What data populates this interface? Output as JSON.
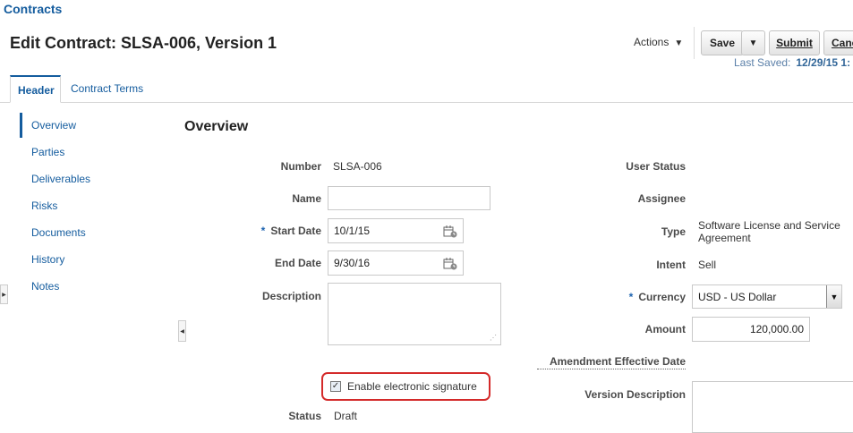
{
  "breadcrumb": "Contracts",
  "page_title": "Edit Contract: SLSA-006, Version 1",
  "toolbar": {
    "actions_label": "Actions",
    "save_label": "Save",
    "submit_label": "Submit",
    "cancel_label": "Canc",
    "last_saved_label": "Last Saved:",
    "last_saved_value": "12/29/15 1:"
  },
  "tabs": [
    {
      "label": "Header",
      "active": true
    },
    {
      "label": "Contract Terms",
      "active": false
    }
  ],
  "sidebar": {
    "items": [
      {
        "label": "Overview",
        "selected": true
      },
      {
        "label": "Parties"
      },
      {
        "label": "Deliverables"
      },
      {
        "label": "Risks"
      },
      {
        "label": "Documents"
      },
      {
        "label": "History"
      },
      {
        "label": "Notes"
      }
    ]
  },
  "overview": {
    "title": "Overview",
    "number_label": "Number",
    "number_value": "SLSA-006",
    "name_label": "Name",
    "name_value": "",
    "start_date_label": "Start Date",
    "start_date_value": "10/1/15",
    "end_date_label": "End Date",
    "end_date_value": "9/30/16",
    "description_label": "Description",
    "description_value": "",
    "esign_label": "Enable electronic signature",
    "esign_checked": true,
    "status_label": "Status",
    "status_value": "Draft",
    "user_status_label": "User Status",
    "assignee_label": "Assignee",
    "type_label": "Type",
    "type_value_line1": "Software License and Service",
    "type_value_line2": "Agreement",
    "intent_label": "Intent",
    "intent_value": "Sell",
    "currency_label": "Currency",
    "currency_value": "USD - US Dollar",
    "amount_label": "Amount",
    "amount_value": "120,000.00",
    "amendment_label": "Amendment Effective Date",
    "version_desc_label": "Version Description",
    "required_marker": "*"
  },
  "colors": {
    "brand_blue": "#145c9e",
    "highlight_red": "#d42a2a"
  }
}
